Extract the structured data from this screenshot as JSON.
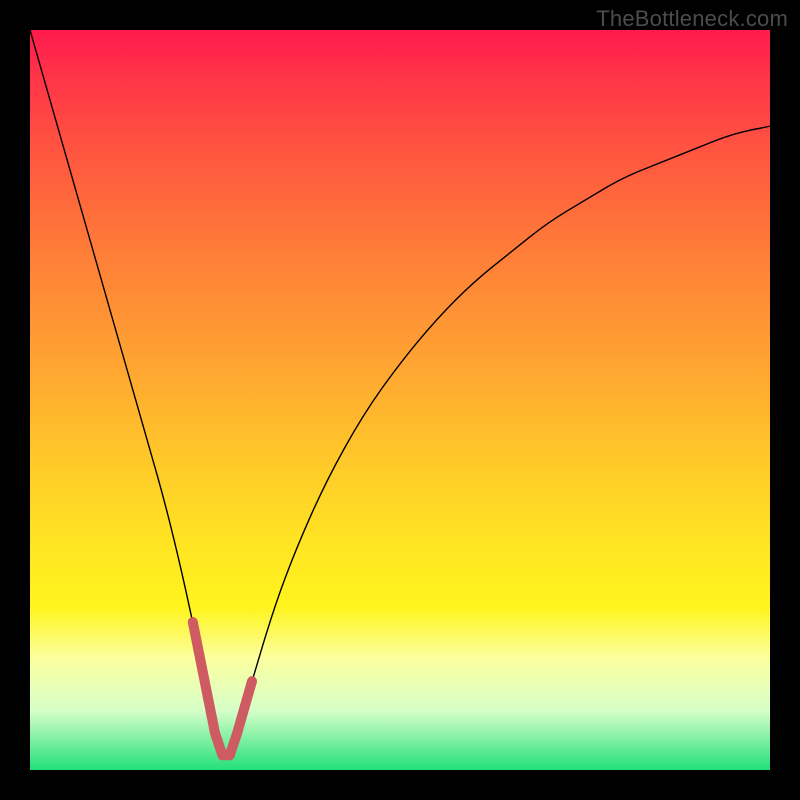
{
  "watermark": "TheBottleneck.com",
  "colors": {
    "anneal_stroke": "#cf5b62",
    "curve_stroke": "#000000"
  },
  "chart_data": {
    "type": "line",
    "title": "",
    "xlabel": "",
    "ylabel": "",
    "xlim": [
      0,
      100
    ],
    "ylim": [
      0,
      100
    ],
    "grid": false,
    "legend": false,
    "series": [
      {
        "name": "bottleneck-curve",
        "x": [
          0,
          2,
          4,
          6,
          8,
          10,
          12,
          14,
          16,
          18,
          20,
          22,
          24,
          25,
          26,
          27,
          28,
          30,
          33,
          36,
          40,
          45,
          50,
          55,
          60,
          65,
          70,
          75,
          80,
          85,
          90,
          95,
          100
        ],
        "y": [
          100,
          93,
          86,
          79,
          72,
          65,
          58,
          51,
          44,
          37,
          29,
          20,
          10,
          5,
          2,
          2,
          5,
          12,
          22,
          30,
          39,
          48,
          55,
          61,
          66,
          70,
          74,
          77,
          80,
          82,
          84,
          86,
          87
        ]
      }
    ],
    "annotations": [
      {
        "name": "highlight-valley",
        "xrange": [
          22,
          30
        ],
        "description": "thick salmon stroke tracing the valley bottom"
      }
    ]
  }
}
